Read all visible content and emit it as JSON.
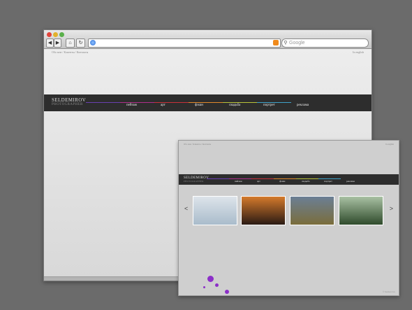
{
  "browser": {
    "nav_back": "◀",
    "nav_forward": "▶",
    "nav_home": "⌂",
    "nav_reload": "↻",
    "search_placeholder": "Google"
  },
  "site": {
    "breadcrumbs": "Обо мне  /  Клиенты  /  Контакты",
    "language_link": "In english",
    "brand_name": "SELDEMIROV",
    "brand_sub": "PHOTOGRAPHER",
    "menu": [
      "пейзаж",
      "арт",
      "фэшн",
      "свадьба",
      "портрет",
      "реклама"
    ],
    "menu_colors": [
      "#6a3fb0",
      "#b02f8a",
      "#c8323a",
      "#e0892b",
      "#b9c23a",
      "#3fa2c8"
    ]
  },
  "preview": {
    "arrow_prev": "<",
    "arrow_next": ">",
    "gallery": [
      {
        "name": "sea-haze-photo",
        "colors": [
          "#dde4ea",
          "#a9bccb"
        ]
      },
      {
        "name": "sunset-couple-photo",
        "colors": [
          "#d57a2b",
          "#2a1a14"
        ]
      },
      {
        "name": "mountain-valley-photo",
        "colors": [
          "#6b7f95",
          "#7a6d3b"
        ]
      },
      {
        "name": "forest-photo",
        "colors": [
          "#a9c1a3",
          "#2f4b2c"
        ]
      }
    ],
    "splash_color": "#8c2fc8"
  }
}
